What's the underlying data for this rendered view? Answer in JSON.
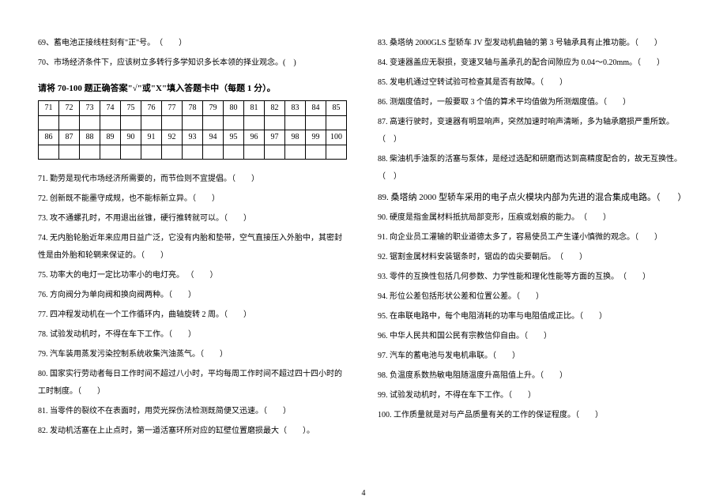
{
  "left": {
    "q69": "69、蓄电池正接线柱刻有\"正\"号。",
    "q70": "70、市场经济条件下，应该树立多转行多学知识多长本领的择业观念。(",
    "instr": "请将 70-100 题正确答案\"√\"或\"X\"填入答题卡中（每题 1 分）。",
    "row1": [
      "71",
      "72",
      "73",
      "74",
      "75",
      "76",
      "77",
      "78",
      "79",
      "80",
      "81",
      "82",
      "83",
      "84",
      "85"
    ],
    "row2": [
      "86",
      "87",
      "88",
      "89",
      "90",
      "91",
      "92",
      "93",
      "94",
      "95",
      "96",
      "97",
      "98",
      "99",
      "100"
    ],
    "q71": "71. 勤劳是现代市场经济所需要的，而节俭则不宜提倡。（",
    "q72": "72. 创新既不能墨守成规，也不能标新立异。（",
    "q73": "73. 攻不通螺孔时，不用退出丝锥，硬行推转就可以。（",
    "q74": "74. 无内胎轮胎近年来应用日益广泛，它没有内胎和垫带，空气直接压入外胎中，其密封性是由外胎和轮辋来保证的。（",
    "q75": "75. 功率大的电灯一定比功率小的电灯亮。 （",
    "q76": "76. 方向阀分为单向阀和换向阀两种。（",
    "q77": "77. 四冲程发动机在一个工作循环内，曲轴旋转 2 周。（",
    "q78": "78. 试验发动机时，不得在车下工作。（",
    "q79": "79. 汽车装用蒸发污染控制系统收集汽油蒸气。（",
    "q80": "80. 国家实行劳动者每日工作时间不超过八小时，平均每周工作时间不超过四十四小时的工时制度。（",
    "q81": "81. 当零件的裂纹不在表面时，用荧光探伤法检测既简便又迅速。（",
    "q82": "82. 发动机活塞在上止点时，第一道活塞环所对应的缸壁位置磨损最大（"
  },
  "right": {
    "q83": "83. 桑塔纳 2000GLS 型轿车 JV 型发动机曲轴的第 3 号轴承具有止推功能。（",
    "q84": "84. 变速器盖应无裂损，变速叉轴与盖承孔的配合间隙应为 0.04～0.20mm。（",
    "q85": "85. 发电机通过空转试验可检查其是否有故障。（",
    "q86": "86. 测烟度值时，一般要取 3 个值的算术平均值做为所测烟度值。（",
    "q87": "87. 高速行驶时，变速器有明显响声，突然加速时响声清晰，多为轴承磨损严重所致。（",
    "q88": "88. 柴油机手油泵的活塞与泵体，是经过选配和研磨而达到高精度配合的，故无互换性。（",
    "q89": "89. 桑塔纳 2000 型轿车采用的电子点火模块内部为先进的混合集成电路。（",
    "q90": "90. 硬度是指金属材料抵抗局部变形，压痕或划痕的能力。",
    "q91": "91. 向企业员工灌输的职业道德太多了，容易使员工产生谨小慎微的观念。（",
    "q92": "92. 锯割金属材料安装锯条时，锯齿的齿尖要朝后。",
    "q93": "93. 零件的互换性包括几何参数、力学性能和理化性能等方面的互换。",
    "q94": "94.  形位公差包括形状公差和位置公差。（",
    "q95": "95.  在串联电路中，每个电阻消耗的功率与电阻值成正比。（",
    "q96": "96.  中华人民共和国公民有宗教信仰自由。（",
    "q97": "97.  汽车的蓄电池与发电机串联。（",
    "q98": "98.  负温度系数热敏电阻随温度升高阻值上升。（",
    "q99": "99.  试验发动机时，不得在车下工作。（",
    "q100": "100.  工作质量就是对与产品质量有关的工作的保证程度。（"
  },
  "page": "4"
}
